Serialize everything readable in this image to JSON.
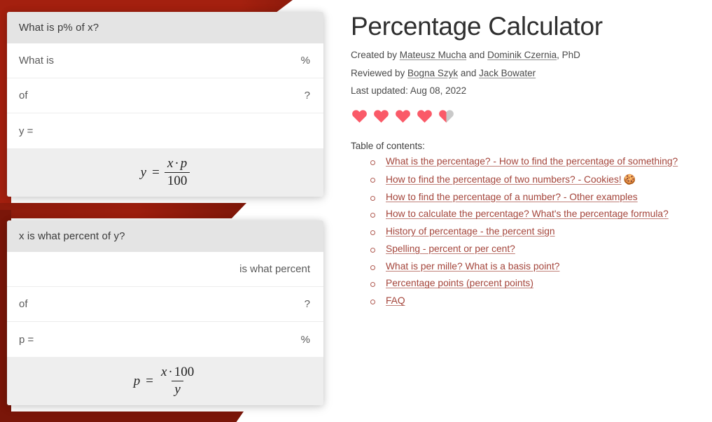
{
  "theme": {
    "brand_red": "#a4200f",
    "brand_red_dark": "#7a1609",
    "link_red": "#a4453b",
    "heart_filled": "#fa5a68",
    "heart_empty": "#c9c9c9"
  },
  "calculators": [
    {
      "header": "What is p% of x?",
      "rows": [
        {
          "label": "What is",
          "unit": "%",
          "value": ""
        },
        {
          "label": "of",
          "unit": "?",
          "value": ""
        },
        {
          "label": "y =",
          "unit": "",
          "value": ""
        }
      ],
      "formula": {
        "lhs": "y",
        "equals": "=",
        "numerator_var": "x",
        "numerator_op": "·",
        "numerator_var2": "p",
        "denominator": "100"
      }
    },
    {
      "header": "x is what percent of y?",
      "rows": [
        {
          "label": "",
          "unit": "is what percent",
          "value": ""
        },
        {
          "label": "of",
          "unit": "?",
          "value": ""
        },
        {
          "label": "p =",
          "unit": "%",
          "value": ""
        }
      ],
      "formula": {
        "lhs": "p",
        "equals": "=",
        "numerator_var": "x",
        "numerator_op": "·",
        "numerator_var2": "100",
        "denominator": "y"
      }
    }
  ],
  "article": {
    "title": "Percentage Calculator",
    "created_prefix": "Created by ",
    "created_author_1": "Mateusz Mucha",
    "created_conjunction": " and ",
    "created_author_2": "Dominik Czernia",
    "created_suffix": ", PhD",
    "reviewed_prefix": "Reviewed by ",
    "reviewed_author_1": "Bogna Szyk",
    "reviewed_conjunction": " and ",
    "reviewed_author_2": "Jack Bowater",
    "last_updated": "Last updated: Aug 08, 2022",
    "rating": {
      "value": 4.5,
      "max": 5,
      "hearts": [
        "full",
        "full",
        "full",
        "full",
        "half"
      ]
    },
    "toc_title": "Table of contents:",
    "toc": [
      {
        "label": "What is the percentage? - How to find the percentage of something?",
        "emoji": ""
      },
      {
        "label": "How to find the percentage of two numbers? - Cookies!",
        "emoji": "🍪"
      },
      {
        "label": "How to find the percentage of a number? - Other examples",
        "emoji": ""
      },
      {
        "label": "How to calculate the percentage? What's the percentage formula?",
        "emoji": ""
      },
      {
        "label": "History of percentage - the percent sign",
        "emoji": ""
      },
      {
        "label": "Spelling - percent or per cent?",
        "emoji": ""
      },
      {
        "label": "What is per mille? What is a basis point?",
        "emoji": ""
      },
      {
        "label": "Percentage points (percent points)",
        "emoji": ""
      },
      {
        "label": "FAQ",
        "emoji": ""
      }
    ]
  }
}
